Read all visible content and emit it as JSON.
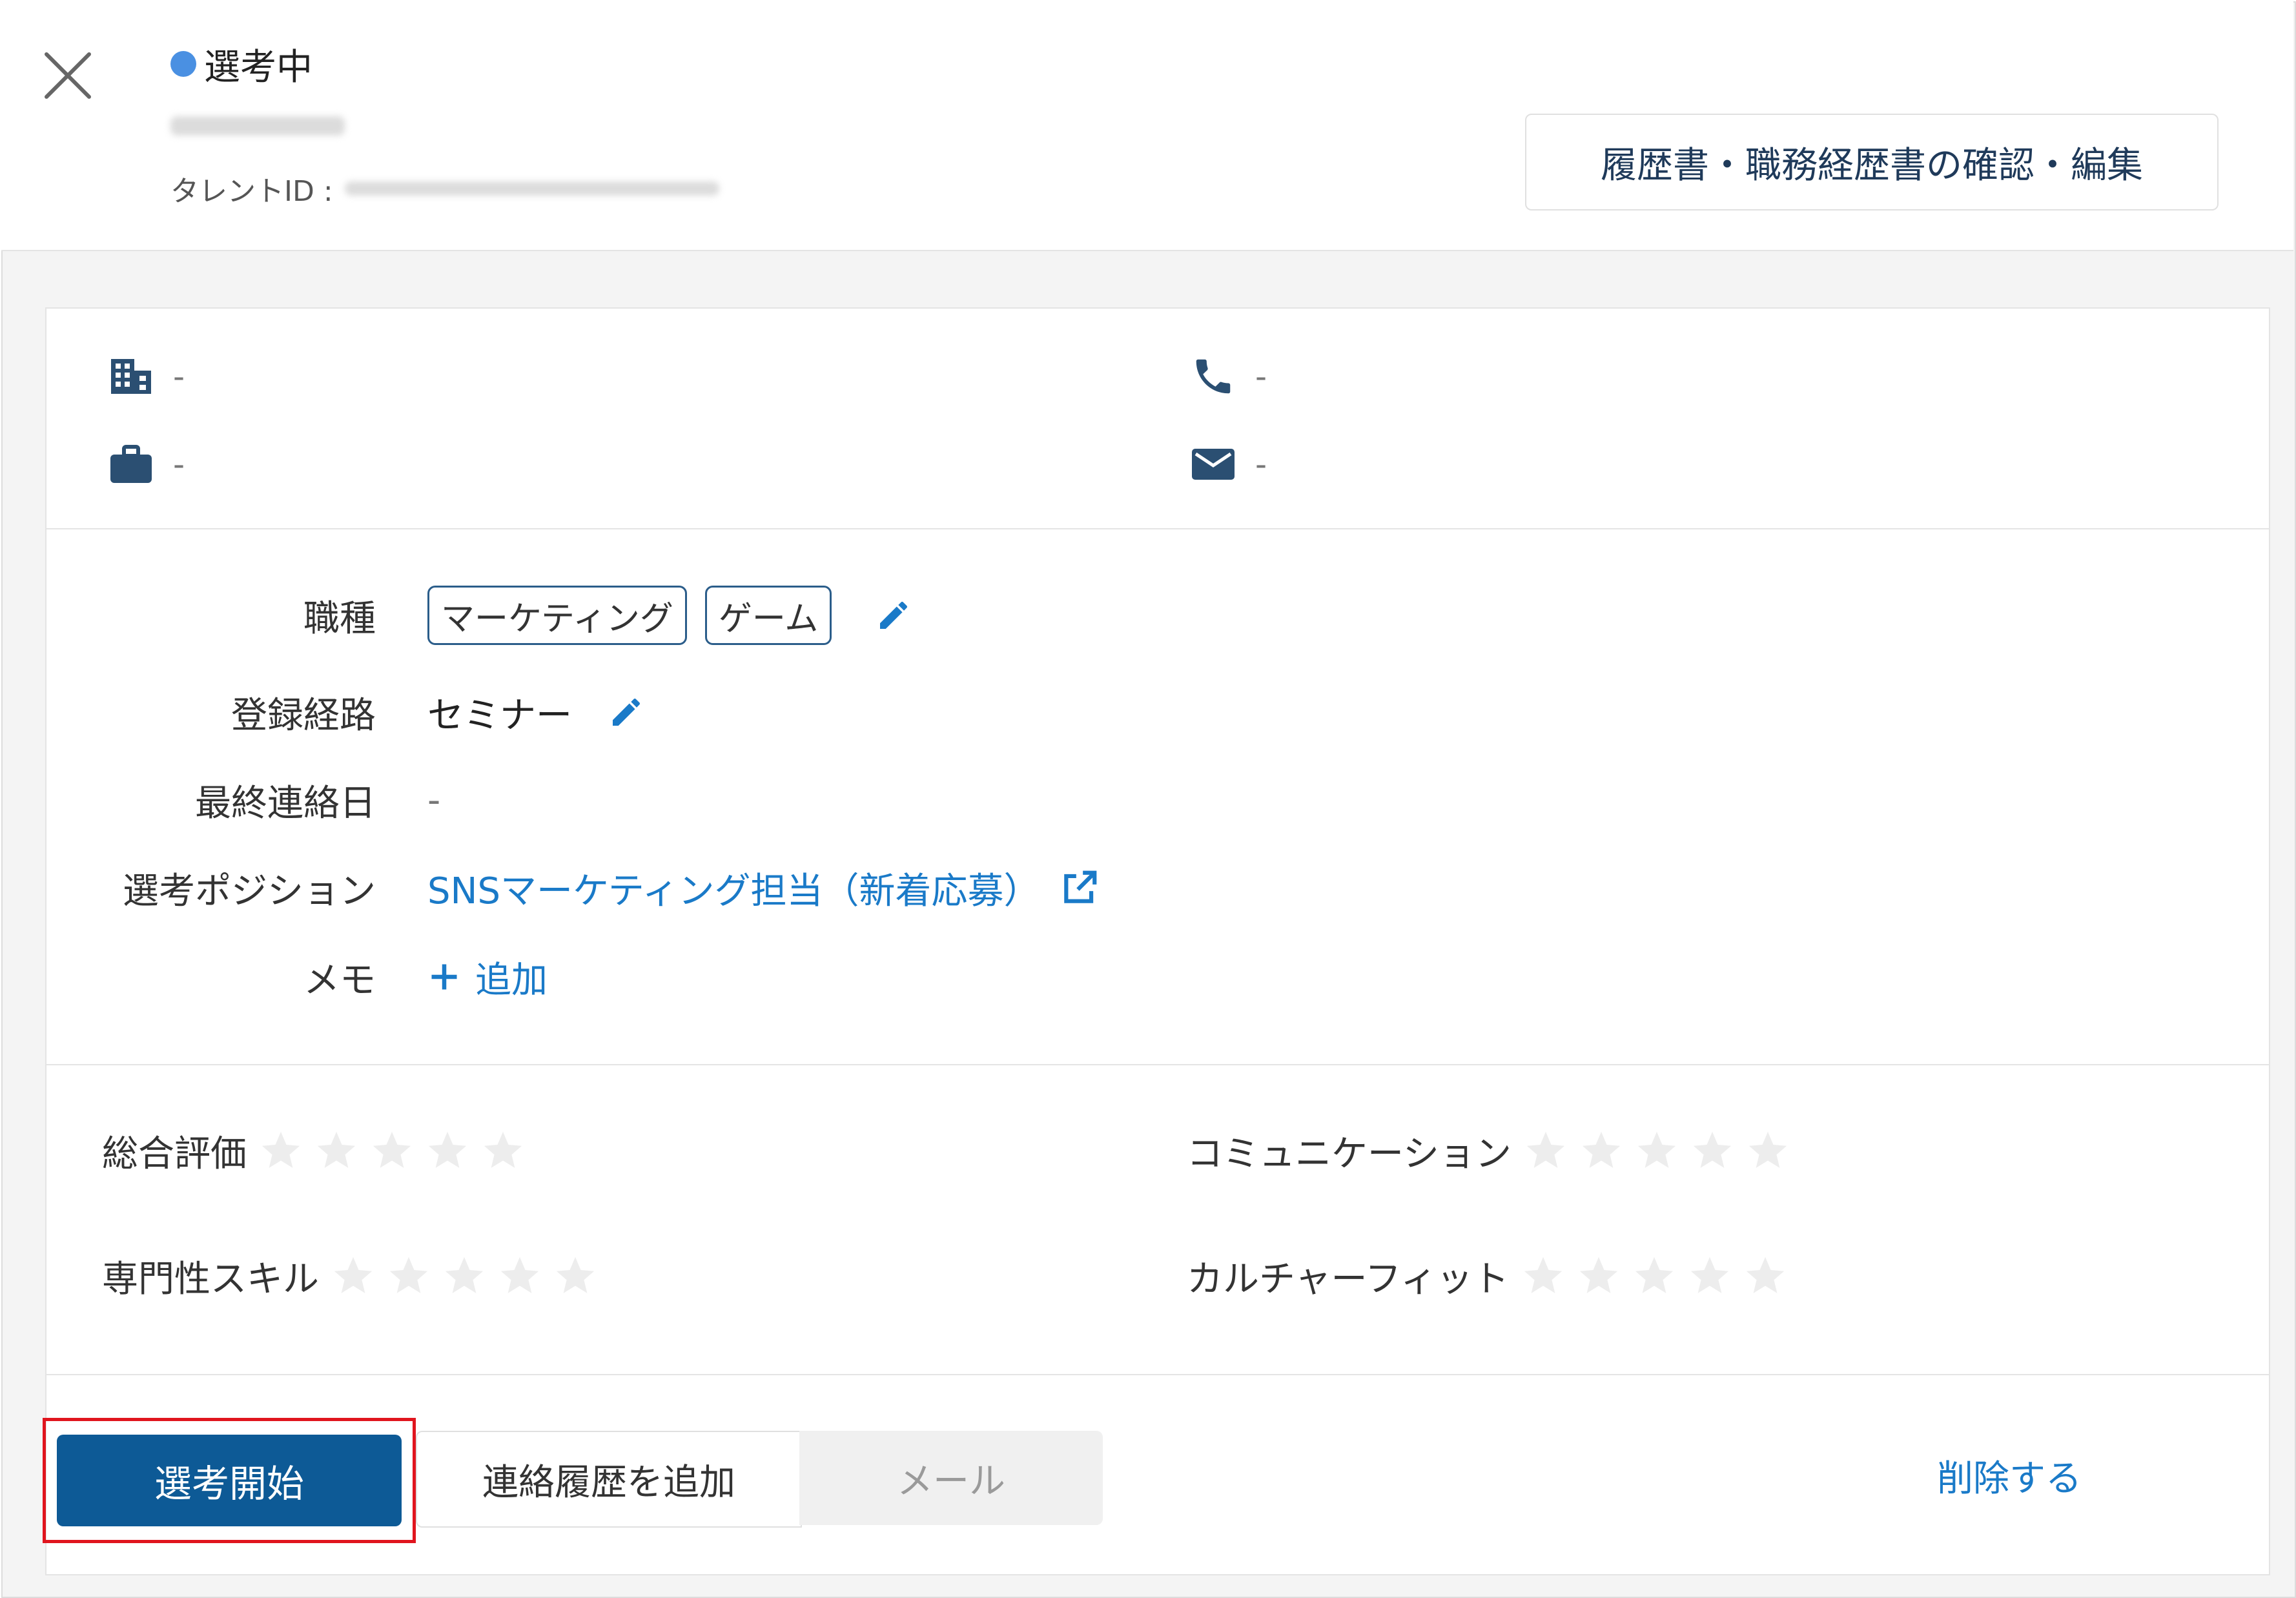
{
  "header": {
    "status_label": "選考中",
    "status_color": "#4a90e2",
    "talent_id_label": "タレントID :",
    "resume_button": "履歴書・職務経歴書の確認・編集",
    "close_icon": "close-icon"
  },
  "contact": {
    "company": "-",
    "position": "-",
    "phone": "-",
    "email": "-",
    "icons": [
      "building-icon",
      "briefcase-icon",
      "phone-icon",
      "mail-icon"
    ]
  },
  "details": {
    "job_type": {
      "label": "職種",
      "tags": [
        "マーケティング",
        "ゲーム"
      ]
    },
    "source": {
      "label": "登録経路",
      "value": "セミナー"
    },
    "last_contact": {
      "label": "最終連絡日",
      "value": "-"
    },
    "position": {
      "label": "選考ポジション",
      "value": "SNSマーケティング担当（新着応募）"
    },
    "memo": {
      "label": "メモ",
      "add_label": "追加"
    }
  },
  "ratings": {
    "overall": {
      "label": "総合評価",
      "value": 0,
      "max": 5
    },
    "communication": {
      "label": "コミュニケーション",
      "value": 0,
      "max": 5
    },
    "expertise": {
      "label": "専門性スキル",
      "value": 0,
      "max": 5
    },
    "culture_fit": {
      "label": "カルチャーフィット",
      "value": 0,
      "max": 5
    }
  },
  "actions": {
    "start_selection": "選考開始",
    "add_contact_history": "連絡履歴を追加",
    "mail": "メール",
    "delete": "削除する"
  },
  "colors": {
    "primary": "#0d5a96",
    "link": "#1a7ac8",
    "highlight": "#e0151e",
    "star_empty": "#ededed"
  }
}
